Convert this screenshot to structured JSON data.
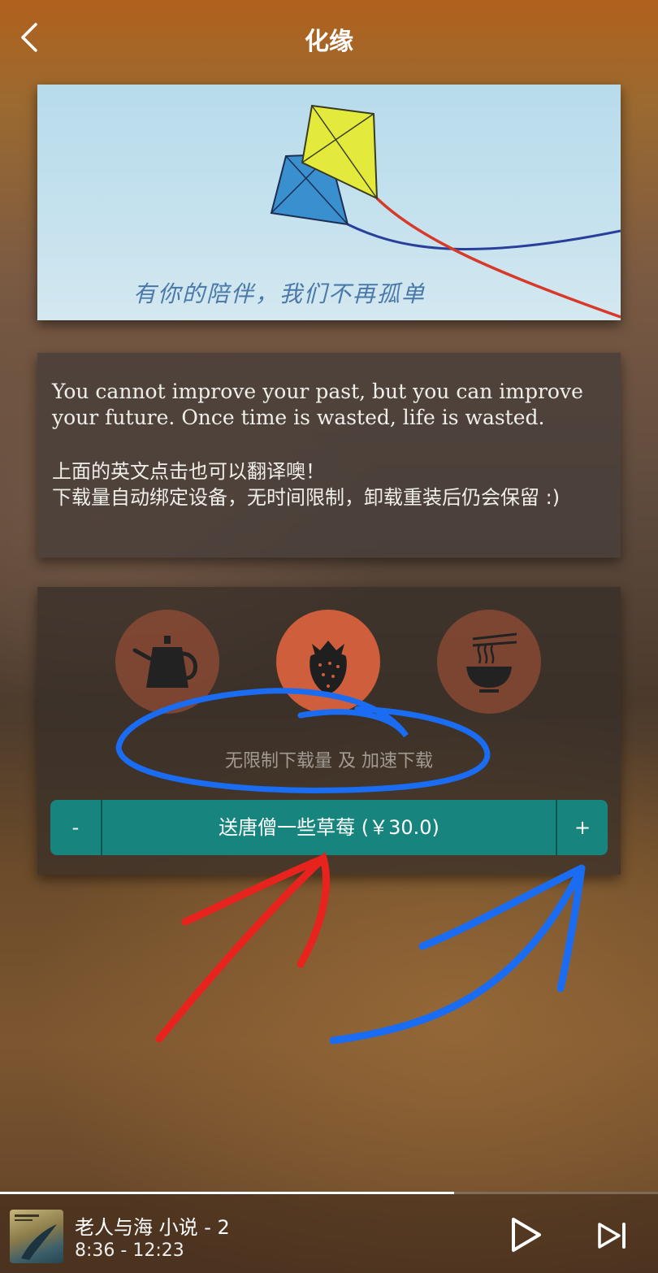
{
  "header": {
    "title": "化缘",
    "back_icon": "chevron-left-icon"
  },
  "banner": {
    "caption": "有你的陪伴，我们不再孤单"
  },
  "quote": {
    "english": "You cannot improve your past, but you can improve your future. Once time is wasted, life is wasted.",
    "chinese_line1": "上面的英文点击也可以翻译噢！",
    "chinese_line2": "下载量自动绑定设备，无时间限制，卸载重装后仍会保留 :)"
  },
  "donate": {
    "options": [
      {
        "icon": "teapot-icon",
        "selected": false
      },
      {
        "icon": "strawberry-icon",
        "selected": true
      },
      {
        "icon": "noodle-bowl-icon",
        "selected": false
      }
    ],
    "description": "无限制下载量 及 加速下载",
    "minus_label": "-",
    "button_label": "送唐僧一些草莓 (￥30.0)",
    "plus_label": "+",
    "accent_color": "#17857d",
    "option_color": "#cf5e3c"
  },
  "player": {
    "title": "老人与海 小说 - 2",
    "time": "8:36 - 12:23",
    "progress": 0.69,
    "play_icon": "play-icon",
    "next_icon": "skip-next-icon"
  },
  "annotations": {
    "circle_color": "#1a6df2",
    "arrow_colors": [
      "#e8231e",
      "#1a6df2"
    ]
  }
}
